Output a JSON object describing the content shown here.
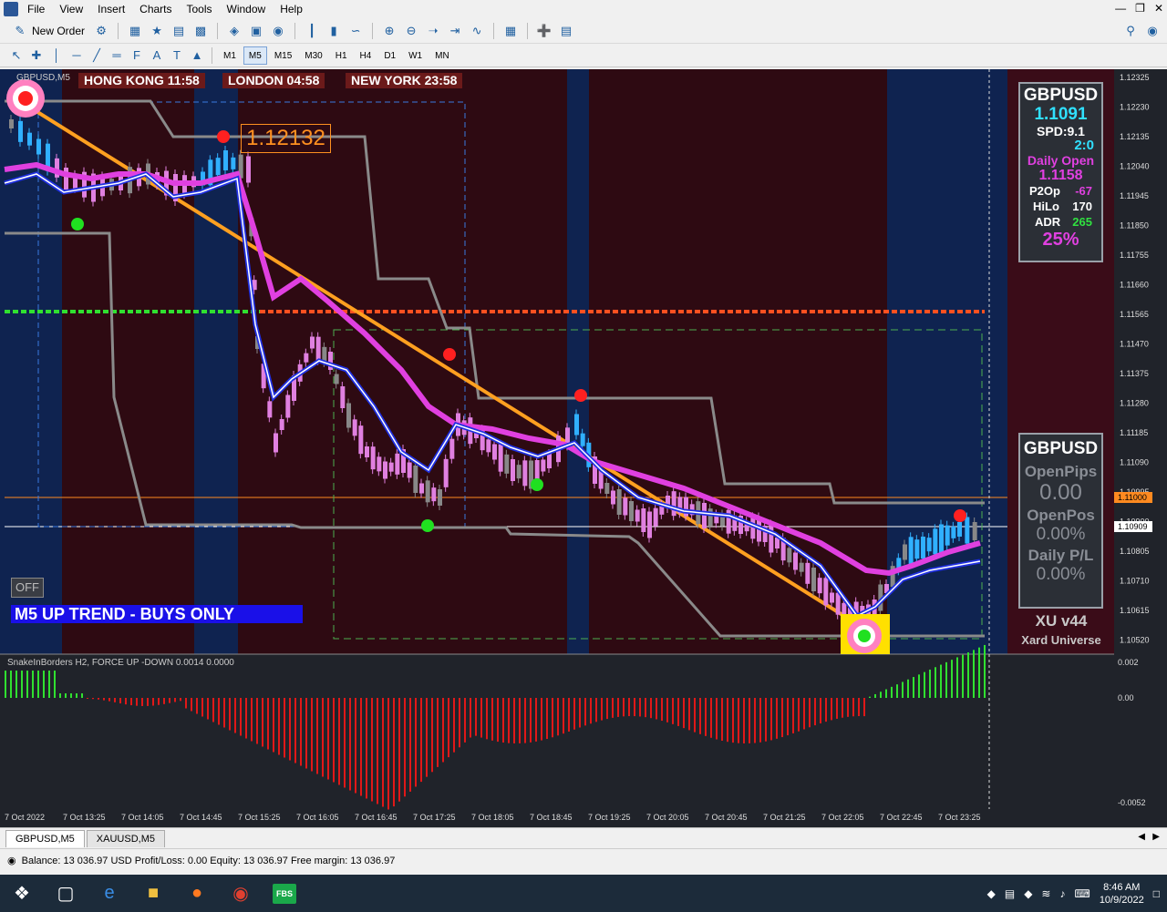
{
  "menu": {
    "items": [
      "File",
      "View",
      "Insert",
      "Charts",
      "Tools",
      "Window",
      "Help"
    ]
  },
  "toolbar": {
    "new_order_label": "New Order"
  },
  "timeframes": {
    "items": [
      "M1",
      "M5",
      "M15",
      "M30",
      "H1",
      "H4",
      "D1",
      "W1",
      "MN"
    ],
    "active": "M5"
  },
  "chart": {
    "symbol_label": "GBPUSD,M5",
    "sessions": [
      {
        "label": "HONG KONG 11:58"
      },
      {
        "label": "LONDON  04:58"
      },
      {
        "label": "NEW YORK 23:58"
      }
    ],
    "high_label": "1.12132",
    "trend_label": "M5 UP TREND - BUYS ONLY",
    "off_label": "OFF",
    "price_axis": [
      "1.12325",
      "1.12230",
      "1.12135",
      "1.12040",
      "1.11945",
      "1.11850",
      "1.11755",
      "1.11660",
      "1.11565",
      "1.11470",
      "1.11375",
      "1.11280",
      "1.11185",
      "1.11090",
      "1.10995",
      "1.10900",
      "1.10805",
      "1.10710",
      "1.10615",
      "1.10520"
    ],
    "price_tag_orange": "1.11000",
    "price_tag_current": "1.10909",
    "time_axis": [
      "7 Oct 2022",
      "7 Oct 13:25",
      "7 Oct 14:05",
      "7 Oct 14:45",
      "7 Oct 15:25",
      "7 Oct 16:05",
      "7 Oct 16:45",
      "7 Oct 17:25",
      "7 Oct 18:05",
      "7 Oct 18:45",
      "7 Oct 19:25",
      "7 Oct 20:05",
      "7 Oct 20:45",
      "7 Oct 21:25",
      "7 Oct 22:05",
      "7 Oct 22:45",
      "7 Oct 23:25"
    ],
    "indicator_label": "SnakeInBorders H2, FORCE UP -DOWN  0.0014 0.0000",
    "indicator_axis": [
      "0.002",
      "0.00",
      "-0.0052"
    ]
  },
  "info_panel": {
    "symbol": "GBPUSD",
    "price": "1.1091",
    "spd": "SPD:9.1",
    "ratio": "2:0",
    "daily_open_label": "Daily Open",
    "daily_open": "1.1158",
    "p2op_label": "P2Op",
    "p2op": "-67",
    "hilo_label": "HiLo",
    "hilo": "170",
    "adr_label": "ADR",
    "adr": "265",
    "pct": "25%"
  },
  "pos_panel": {
    "symbol": "GBPUSD",
    "open_pips_label": "OpenPips",
    "open_pips": "0.00",
    "open_pos_label": "OpenPos",
    "open_pos": "0.00%",
    "daily_pl_label": "Daily P/L",
    "daily_pl": "0.00%",
    "brand": "XU v44",
    "brand_sub": "Xard Universe"
  },
  "tabs": {
    "items": [
      "GBPUSD,M5",
      "XAUUSD,M5"
    ],
    "active": "GBPUSD,M5"
  },
  "status": {
    "text": "Balance: 13 036.97 USD  Profit/Loss: 0.00  Equity: 13 036.97  Free margin: 13 036.97"
  },
  "taskbar": {
    "fbs_label": "FBS",
    "time": "8:46 AM",
    "date": "10/9/2022"
  },
  "colors": {
    "session_bg": "#2e0a12",
    "session_blue": "#0f2350",
    "magenta": "#e040e0",
    "orange": "#ffa020",
    "blue_ma": "#2030e0"
  }
}
